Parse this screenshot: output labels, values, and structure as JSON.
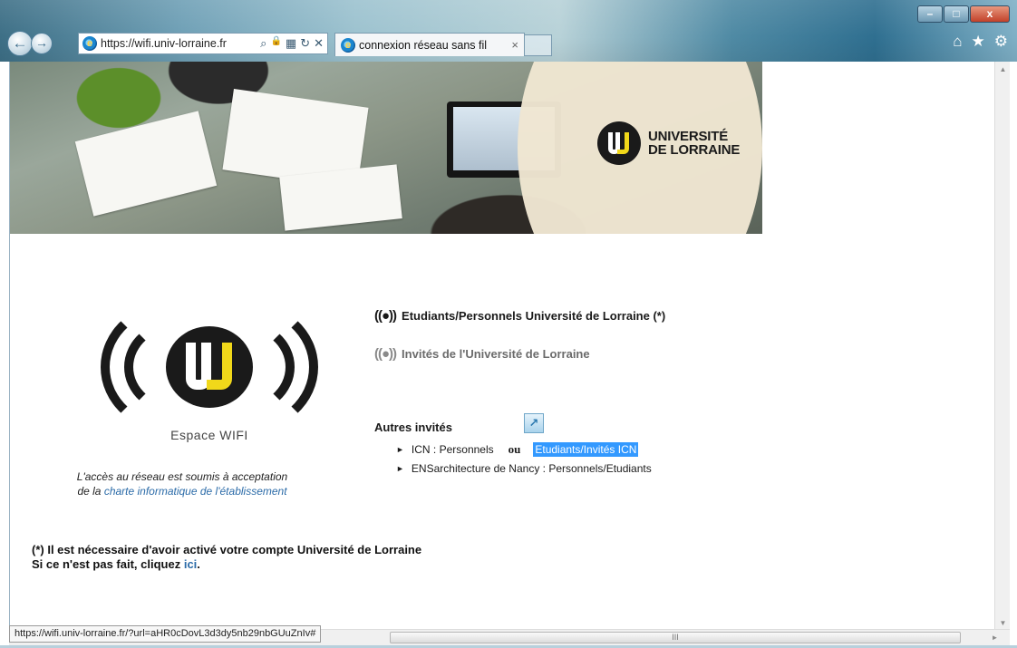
{
  "browser": {
    "url": "https://wifi.univ-lorraine.fr",
    "tab_title": "connexion réseau sans fil",
    "tab_close": "×",
    "status_url": "https://wifi.univ-lorraine.fr/?url=aHR0cDovL3d3dy5nb29nbGUuZnIv#",
    "hscroll_grip": "III",
    "buttons": {
      "back": "←",
      "forward": "→",
      "minimize": "–",
      "maximize": "□",
      "close": "x",
      "home": "⌂",
      "favorites": "★",
      "tools": "⚙",
      "search": "⌕",
      "lock": "🔒",
      "compat": "▦",
      "refresh": "↻",
      "stop": "✕"
    }
  },
  "banner": {
    "brand_line1": "UNIVERSITÉ",
    "brand_line2": "DE LORRAINE"
  },
  "wifi": {
    "caption": "Espace WIFI",
    "note_line1": "L'accès au réseau est soumis à acceptation",
    "note_prefix": "de la ",
    "note_link": "charte informatique de l'établissement"
  },
  "networks": {
    "symbol": "((●))",
    "main_label": "Etudiants/Personnels Université de Lorraine (*)",
    "guest_label": "Invités de l'Université de Lorraine"
  },
  "others": {
    "heading": "Autres invités",
    "ext_icon": "↗",
    "bullet": "►",
    "icn_label": "ICN : Personnels",
    "ou": "ou",
    "icn_students": "Etudiants/Invités ICN",
    "ensa_label": "ENSarchitecture de Nancy : Personnels/Etudiants"
  },
  "footnote": {
    "line1": "(*) Il est nécessaire d'avoir activé votre compte Université de Lorraine",
    "line2_prefix": "Si ce n'est pas fait, cliquez ",
    "link": "ici",
    "line2_suffix": "."
  },
  "colors": {
    "accent_yellow": "#f1d81a",
    "link_blue": "#2b6ba8",
    "highlight": "#3399ff"
  }
}
